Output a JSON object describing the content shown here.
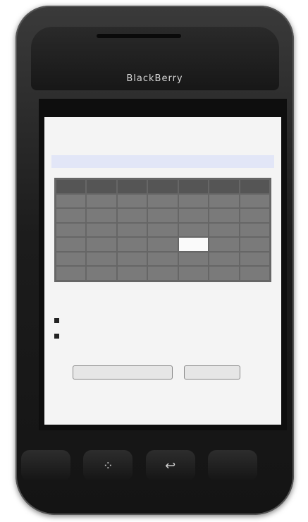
{
  "device": {
    "brand": "BlackBerry"
  },
  "status_bar": {
    "carrier": "",
    "network": "",
    "time": ""
  },
  "page": {
    "title": "",
    "logout_label": "",
    "nav": [
      "",
      "",
      ""
    ]
  },
  "calendar": {
    "weekdays": [
      "",
      "",
      "",
      "",
      "",
      "",
      ""
    ],
    "weeks": [
      [
        "",
        "",
        "",
        "",
        "",
        "",
        ""
      ],
      [
        "",
        "",
        "",
        "",
        "",
        "",
        ""
      ],
      [
        "",
        "",
        "",
        "",
        "",
        "",
        ""
      ],
      [
        "",
        "",
        "",
        "",
        "",
        "",
        ""
      ],
      [
        "",
        "",
        "",
        "",
        "",
        "",
        ""
      ],
      [
        "",
        "",
        "",
        "",
        "",
        "",
        ""
      ]
    ],
    "selected_cell": [
      3,
      4
    ]
  },
  "selected_date": "",
  "appointments_heading": "",
  "appointments": [
    "",
    ""
  ],
  "count_label": "",
  "buttons": {
    "new_label": "",
    "logout_label": ""
  },
  "hardware_keys": {
    "menu_icon": "blackberry-menu-icon",
    "back_icon": "back-arrow-icon"
  }
}
